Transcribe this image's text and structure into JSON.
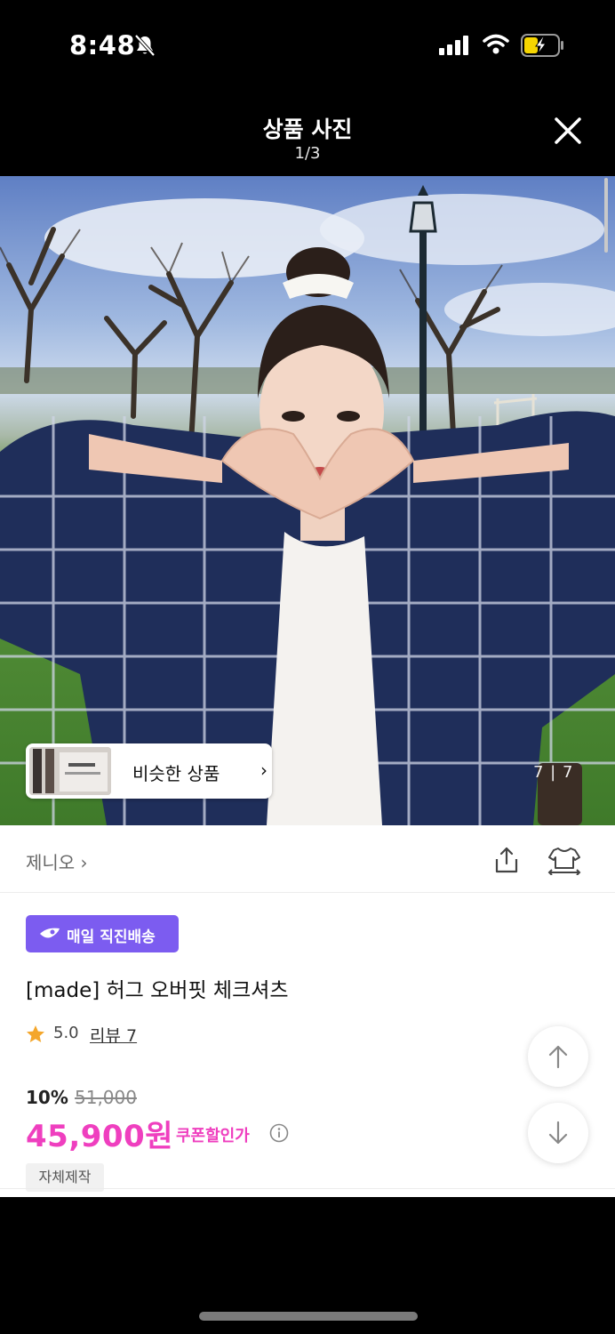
{
  "status_bar": {
    "time": "8:48",
    "icons": [
      "bell-slash-icon",
      "cellular-signal-icon",
      "wifi-icon",
      "battery-charging-icon"
    ]
  },
  "viewer": {
    "title": "상품 사진",
    "counter": "1/3",
    "close_icon": "close-icon",
    "photo_subject": "product-photo",
    "photo_counter": "7 | 7"
  },
  "similar": {
    "label": "비슷한 상품",
    "chevron": "›"
  },
  "seller": {
    "name": "제니오 ›",
    "actions": [
      "share-icon",
      "try-on-icon"
    ]
  },
  "product": {
    "badge_label": "매일 직진배송",
    "title": "[made] 허그 오버핏 체크셔츠",
    "rating": "5.0",
    "review_link": "리뷰 7",
    "discount_rate": "10%",
    "original_price": "51,000",
    "sale_price": "45,900원",
    "coupon_label": "쿠폰할인가",
    "tag": "자체제작"
  },
  "colors": {
    "accent_pink": "#ef3fbf",
    "delivery_purple": "#7c5cf0"
  }
}
